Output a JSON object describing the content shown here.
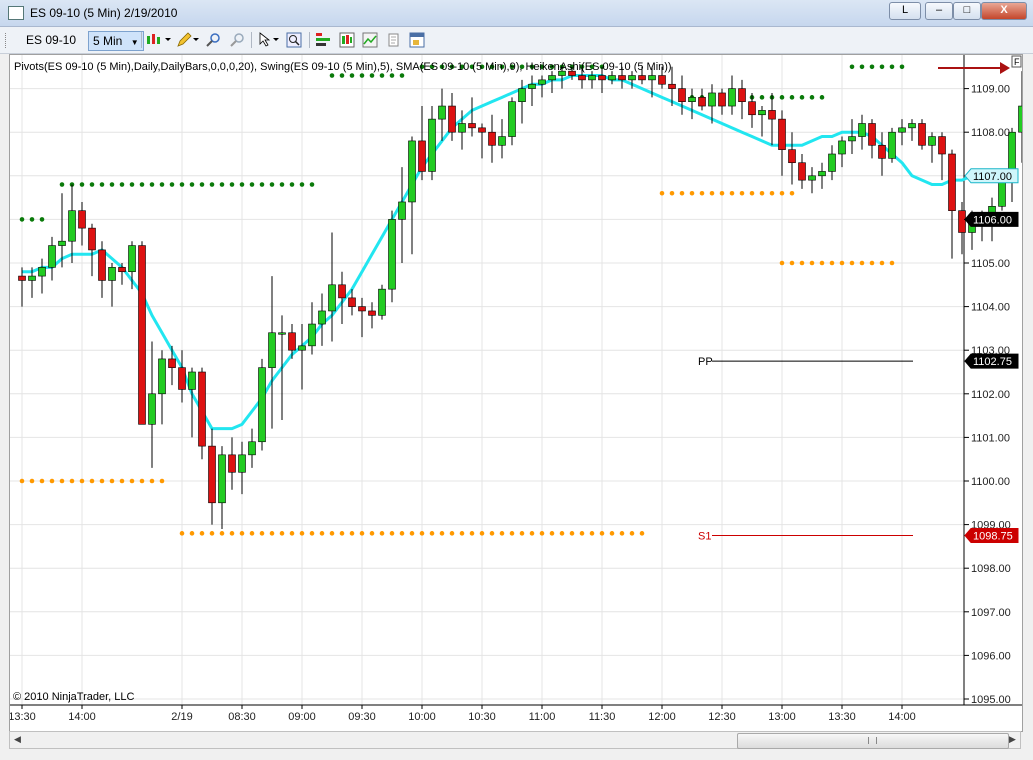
{
  "window": {
    "title": "ES 09-10 (5 Min)  2/19/2010",
    "btn_l": "L",
    "btn_min": "–",
    "btn_max": "□",
    "btn_close": "X"
  },
  "toolbar": {
    "instrument": "ES 09-10",
    "interval": "5 Min"
  },
  "chart": {
    "indicator_label": "Pivots(ES 09-10 (5 Min),Daily,DailyBars,0,0,0,20), Swing(ES 09-10 (5 Min),5), SMA(ES 09-10 (5 Min),9), HeikenAshi(ES 09-10 (5 Min))",
    "copyright": "© 2010 NinjaTrader, LLC",
    "corner_button": "F",
    "colors": {
      "up": "#22cc22",
      "down": "#dd1111",
      "sma": "#22e6f0",
      "swing_high": "#0a7a0a",
      "swing_low": "#ff9900"
    }
  },
  "chart_data": {
    "type": "candlestick",
    "ylim": [
      1094.8,
      1109.6
    ],
    "y_ticks": [
      "1095.00",
      "1096.00",
      "1097.00",
      "1098.00",
      "1099.00",
      "1100.00",
      "1101.00",
      "1102.00",
      "1103.00",
      "1104.00",
      "1105.00",
      "1106.00",
      "1107.00",
      "1108.00",
      "1109.00"
    ],
    "x_tick_labels": [
      "13:30",
      "14:00",
      "2/19",
      "08:30",
      "09:00",
      "09:30",
      "10:00",
      "10:30",
      "11:00",
      "11:30",
      "12:00",
      "12:30",
      "13:00",
      "13:30",
      "14:00"
    ],
    "x_tick_bars": [
      0,
      6,
      16,
      22,
      28,
      34,
      40,
      46,
      52,
      58,
      64,
      70,
      76,
      82,
      88
    ],
    "candles": [
      {
        "o": 1104.7,
        "h": 1104.9,
        "l": 1104.0,
        "c": 1104.6
      },
      {
        "o": 1104.6,
        "h": 1104.9,
        "l": 1104.2,
        "c": 1104.7
      },
      {
        "o": 1104.7,
        "h": 1105.1,
        "l": 1104.3,
        "c": 1104.9
      },
      {
        "o": 1104.9,
        "h": 1105.6,
        "l": 1104.6,
        "c": 1105.4
      },
      {
        "o": 1105.4,
        "h": 1106.6,
        "l": 1104.9,
        "c": 1105.5
      },
      {
        "o": 1105.5,
        "h": 1106.8,
        "l": 1105.0,
        "c": 1106.2
      },
      {
        "o": 1106.2,
        "h": 1106.4,
        "l": 1105.4,
        "c": 1105.8
      },
      {
        "o": 1105.8,
        "h": 1105.9,
        "l": 1104.7,
        "c": 1105.3
      },
      {
        "o": 1105.3,
        "h": 1105.5,
        "l": 1104.2,
        "c": 1104.6
      },
      {
        "o": 1104.6,
        "h": 1105.0,
        "l": 1104.0,
        "c": 1104.9
      },
      {
        "o": 1104.9,
        "h": 1105.0,
        "l": 1104.5,
        "c": 1104.8
      },
      {
        "o": 1104.8,
        "h": 1105.5,
        "l": 1104.4,
        "c": 1105.4
      },
      {
        "o": 1105.4,
        "h": 1105.5,
        "l": 1102.3,
        "c": 1101.3
      },
      {
        "o": 1101.3,
        "h": 1103.2,
        "l": 1100.3,
        "c": 1102.0
      },
      {
        "o": 1102.0,
        "h": 1103.0,
        "l": 1101.3,
        "c": 1102.8
      },
      {
        "o": 1102.8,
        "h": 1103.1,
        "l": 1102.2,
        "c": 1102.6
      },
      {
        "o": 1102.6,
        "h": 1103.0,
        "l": 1101.8,
        "c": 1102.1
      },
      {
        "o": 1102.1,
        "h": 1102.6,
        "l": 1101.0,
        "c": 1102.5
      },
      {
        "o": 1102.5,
        "h": 1102.6,
        "l": 1100.5,
        "c": 1100.8
      },
      {
        "o": 1100.8,
        "h": 1101.2,
        "l": 1099.0,
        "c": 1099.5
      },
      {
        "o": 1099.5,
        "h": 1100.8,
        "l": 1098.9,
        "c": 1100.6
      },
      {
        "o": 1100.6,
        "h": 1101.0,
        "l": 1099.8,
        "c": 1100.2
      },
      {
        "o": 1100.2,
        "h": 1100.9,
        "l": 1099.7,
        "c": 1100.6
      },
      {
        "o": 1100.6,
        "h": 1101.2,
        "l": 1100.3,
        "c": 1100.9
      },
      {
        "o": 1100.9,
        "h": 1102.8,
        "l": 1100.7,
        "c": 1102.6
      },
      {
        "o": 1102.6,
        "h": 1104.7,
        "l": 1101.2,
        "c": 1103.4
      },
      {
        "o": 1103.4,
        "h": 1103.8,
        "l": 1101.4,
        "c": 1103.4
      },
      {
        "o": 1103.4,
        "h": 1103.6,
        "l": 1102.8,
        "c": 1103.0
      },
      {
        "o": 1103.0,
        "h": 1103.6,
        "l": 1102.1,
        "c": 1103.1
      },
      {
        "o": 1103.1,
        "h": 1104.1,
        "l": 1102.9,
        "c": 1103.6
      },
      {
        "o": 1103.6,
        "h": 1104.3,
        "l": 1103.1,
        "c": 1103.9
      },
      {
        "o": 1103.9,
        "h": 1105.7,
        "l": 1103.2,
        "c": 1104.5
      },
      {
        "o": 1104.5,
        "h": 1104.8,
        "l": 1103.6,
        "c": 1104.2
      },
      {
        "o": 1104.2,
        "h": 1104.4,
        "l": 1103.8,
        "c": 1104.0
      },
      {
        "o": 1104.0,
        "h": 1104.2,
        "l": 1103.3,
        "c": 1103.9
      },
      {
        "o": 1103.9,
        "h": 1104.1,
        "l": 1103.5,
        "c": 1103.8
      },
      {
        "o": 1103.8,
        "h": 1104.5,
        "l": 1103.7,
        "c": 1104.4
      },
      {
        "o": 1104.4,
        "h": 1106.2,
        "l": 1104.1,
        "c": 1106.0
      },
      {
        "o": 1106.0,
        "h": 1107.2,
        "l": 1105.0,
        "c": 1106.4
      },
      {
        "o": 1106.4,
        "h": 1107.9,
        "l": 1105.2,
        "c": 1107.8
      },
      {
        "o": 1107.8,
        "h": 1108.6,
        "l": 1106.9,
        "c": 1107.1
      },
      {
        "o": 1107.1,
        "h": 1108.6,
        "l": 1106.9,
        "c": 1108.3
      },
      {
        "o": 1108.3,
        "h": 1109.0,
        "l": 1107.8,
        "c": 1108.6
      },
      {
        "o": 1108.6,
        "h": 1108.9,
        "l": 1107.8,
        "c": 1108.0
      },
      {
        "o": 1108.0,
        "h": 1108.5,
        "l": 1107.6,
        "c": 1108.2
      },
      {
        "o": 1108.2,
        "h": 1108.8,
        "l": 1107.9,
        "c": 1108.1
      },
      {
        "o": 1108.1,
        "h": 1108.2,
        "l": 1107.4,
        "c": 1108.0
      },
      {
        "o": 1108.0,
        "h": 1108.4,
        "l": 1107.3,
        "c": 1107.7
      },
      {
        "o": 1107.7,
        "h": 1108.3,
        "l": 1107.4,
        "c": 1107.9
      },
      {
        "o": 1107.9,
        "h": 1108.8,
        "l": 1107.7,
        "c": 1108.7
      },
      {
        "o": 1108.7,
        "h": 1109.2,
        "l": 1108.2,
        "c": 1109.0
      },
      {
        "o": 1109.0,
        "h": 1109.3,
        "l": 1108.6,
        "c": 1109.1
      },
      {
        "o": 1109.1,
        "h": 1109.3,
        "l": 1108.8,
        "c": 1109.2
      },
      {
        "o": 1109.2,
        "h": 1109.4,
        "l": 1108.9,
        "c": 1109.3
      },
      {
        "o": 1109.3,
        "h": 1109.5,
        "l": 1109.0,
        "c": 1109.4
      },
      {
        "o": 1109.4,
        "h": 1109.5,
        "l": 1109.2,
        "c": 1109.3
      },
      {
        "o": 1109.3,
        "h": 1109.5,
        "l": 1109.0,
        "c": 1109.2
      },
      {
        "o": 1109.2,
        "h": 1109.4,
        "l": 1109.0,
        "c": 1109.3
      },
      {
        "o": 1109.3,
        "h": 1109.5,
        "l": 1108.9,
        "c": 1109.2
      },
      {
        "o": 1109.2,
        "h": 1109.4,
        "l": 1109.1,
        "c": 1109.3
      },
      {
        "o": 1109.3,
        "h": 1109.5,
        "l": 1109.0,
        "c": 1109.2
      },
      {
        "o": 1109.2,
        "h": 1109.4,
        "l": 1109.0,
        "c": 1109.3
      },
      {
        "o": 1109.3,
        "h": 1109.5,
        "l": 1109.1,
        "c": 1109.2
      },
      {
        "o": 1109.2,
        "h": 1109.5,
        "l": 1108.8,
        "c": 1109.3
      },
      {
        "o": 1109.3,
        "h": 1109.5,
        "l": 1109.0,
        "c": 1109.1
      },
      {
        "o": 1109.1,
        "h": 1109.5,
        "l": 1108.6,
        "c": 1109.0
      },
      {
        "o": 1109.0,
        "h": 1109.3,
        "l": 1108.4,
        "c": 1108.7
      },
      {
        "o": 1108.7,
        "h": 1109.0,
        "l": 1108.3,
        "c": 1108.8
      },
      {
        "o": 1108.8,
        "h": 1109.0,
        "l": 1108.5,
        "c": 1108.6
      },
      {
        "o": 1108.6,
        "h": 1109.1,
        "l": 1108.2,
        "c": 1108.9
      },
      {
        "o": 1108.9,
        "h": 1109.0,
        "l": 1108.4,
        "c": 1108.6
      },
      {
        "o": 1108.6,
        "h": 1109.3,
        "l": 1108.4,
        "c": 1109.0
      },
      {
        "o": 1109.0,
        "h": 1109.2,
        "l": 1108.3,
        "c": 1108.7
      },
      {
        "o": 1108.7,
        "h": 1108.9,
        "l": 1108.1,
        "c": 1108.4
      },
      {
        "o": 1108.4,
        "h": 1108.6,
        "l": 1107.9,
        "c": 1108.5
      },
      {
        "o": 1108.5,
        "h": 1108.9,
        "l": 1107.7,
        "c": 1108.3
      },
      {
        "o": 1108.3,
        "h": 1108.5,
        "l": 1107.0,
        "c": 1107.6
      },
      {
        "o": 1107.6,
        "h": 1108.0,
        "l": 1106.8,
        "c": 1107.3
      },
      {
        "o": 1107.3,
        "h": 1107.5,
        "l": 1106.7,
        "c": 1106.9
      },
      {
        "o": 1106.9,
        "h": 1107.2,
        "l": 1106.6,
        "c": 1107.0
      },
      {
        "o": 1107.0,
        "h": 1107.3,
        "l": 1106.7,
        "c": 1107.1
      },
      {
        "o": 1107.1,
        "h": 1107.7,
        "l": 1106.9,
        "c": 1107.5
      },
      {
        "o": 1107.5,
        "h": 1107.9,
        "l": 1107.2,
        "c": 1107.8
      },
      {
        "o": 1107.8,
        "h": 1108.3,
        "l": 1107.5,
        "c": 1107.9
      },
      {
        "o": 1107.9,
        "h": 1108.4,
        "l": 1107.6,
        "c": 1108.2
      },
      {
        "o": 1108.2,
        "h": 1108.3,
        "l": 1107.4,
        "c": 1107.7
      },
      {
        "o": 1107.7,
        "h": 1108.0,
        "l": 1107.0,
        "c": 1107.4
      },
      {
        "o": 1107.4,
        "h": 1108.1,
        "l": 1107.3,
        "c": 1108.0
      },
      {
        "o": 1108.0,
        "h": 1108.3,
        "l": 1107.7,
        "c": 1108.1
      },
      {
        "o": 1108.1,
        "h": 1108.3,
        "l": 1107.8,
        "c": 1108.2
      },
      {
        "o": 1108.2,
        "h": 1108.3,
        "l": 1107.6,
        "c": 1107.7
      },
      {
        "o": 1107.7,
        "h": 1108.0,
        "l": 1107.3,
        "c": 1107.9
      },
      {
        "o": 1107.9,
        "h": 1108.0,
        "l": 1106.9,
        "c": 1107.5
      },
      {
        "o": 1107.5,
        "h": 1107.6,
        "l": 1105.1,
        "c": 1106.2
      },
      {
        "o": 1106.2,
        "h": 1106.4,
        "l": 1105.2,
        "c": 1105.7
      },
      {
        "o": 1105.7,
        "h": 1106.2,
        "l": 1105.3,
        "c": 1106.1
      },
      {
        "o": 1106.1,
        "h": 1106.2,
        "l": 1105.5,
        "c": 1106.0
      },
      {
        "o": 1106.0,
        "h": 1106.5,
        "l": 1105.5,
        "c": 1106.3
      },
      {
        "o": 1106.3,
        "h": 1107.1,
        "l": 1106.2,
        "c": 1107.1
      },
      {
        "o": 1107.1,
        "h": 1108.1,
        "l": 1106.4,
        "c": 1108.0
      },
      {
        "o": 1108.0,
        "h": 1109.4,
        "l": 1107.3,
        "c": 1108.6
      },
      {
        "o": 1108.6,
        "h": 1109.4,
        "l": 1107.1,
        "c": 1107.7
      },
      {
        "o": 1107.7,
        "h": 1107.9,
        "l": 1106.8,
        "c": 1107.0
      },
      {
        "o": 1107.0,
        "h": 1107.9,
        "l": 1106.2,
        "c": 1107.6
      },
      {
        "o": 1107.6,
        "h": 1107.7,
        "l": 1106.0,
        "c": 1106.5
      },
      {
        "o": 1106.5,
        "h": 1107.0,
        "l": 1105.3,
        "c": 1105.9
      },
      {
        "o": 1105.9,
        "h": 1106.5,
        "l": 1105.6,
        "c": 1106.3
      }
    ],
    "sma": [
      1104.8,
      1104.8,
      1104.9,
      1104.9,
      1105.1,
      1105.2,
      1105.2,
      1105.2,
      1105.3,
      1105.1,
      1104.9,
      1104.6,
      1104.3,
      1103.8,
      1103.4,
      1103.0,
      1102.6,
      1102.0,
      1101.6,
      1101.2,
      1101.2,
      1101.2,
      1101.3,
      1101.6,
      1101.9,
      1102.3,
      1102.6,
      1102.9,
      1103.1,
      1103.3,
      1103.6,
      1103.8,
      1104.1,
      1104.4,
      1104.8,
      1105.2,
      1105.6,
      1106.0,
      1106.4,
      1106.8,
      1107.2,
      1107.5,
      1107.8,
      1108.1,
      1108.3,
      1108.5,
      1108.6,
      1108.7,
      1108.8,
      1108.9,
      1109.0,
      1109.1,
      1109.1,
      1109.2,
      1109.2,
      1109.3,
      1109.3,
      1109.3,
      1109.3,
      1109.2,
      1109.2,
      1109.1,
      1109.0,
      1108.9,
      1108.8,
      1108.7,
      1108.6,
      1108.5,
      1108.4,
      1108.3,
      1108.2,
      1108.1,
      1108.0,
      1107.9,
      1107.8,
      1107.7,
      1107.7,
      1107.7,
      1107.7,
      1107.8,
      1107.9,
      1107.9,
      1108.0,
      1108.0,
      1108.0,
      1107.9,
      1107.7,
      1107.5,
      1107.3,
      1107.0,
      1106.9,
      1106.8,
      1106.8,
      1106.9,
      1106.9,
      1107.0,
      1107.0,
      1107.0,
      1107.1,
      1107.1
    ],
    "swing_highs": [
      {
        "y": 1106.0,
        "from": 0,
        "to": 2
      },
      {
        "y": 1106.8,
        "from": 4,
        "to": 29
      },
      {
        "y": 1109.3,
        "from": 31,
        "to": 38
      },
      {
        "y": 1109.5,
        "from": 40,
        "to": 58
      },
      {
        "y": 1108.8,
        "from": 67,
        "to": 80
      },
      {
        "y": 1109.5,
        "from": 83,
        "to": 88
      }
    ],
    "swing_lows": [
      {
        "y": 1100.0,
        "from": 0,
        "to": 14
      },
      {
        "y": 1098.8,
        "from": 16,
        "to": 62
      },
      {
        "y": 1106.6,
        "from": 64,
        "to": 77
      },
      {
        "y": 1105.0,
        "from": 76,
        "to": 87
      }
    ],
    "pivots": [
      {
        "name": "PP",
        "value": 1102.75,
        "label": "1102.75",
        "color": "#000000"
      },
      {
        "name": "S1",
        "value": 1098.75,
        "label": "1098.75",
        "color": "#cc0000"
      }
    ],
    "price_tags": [
      {
        "value": 1107.0,
        "label": "1107.00",
        "bg": "#cff6fb",
        "border": "#1ab6c9",
        "fg": "#000000"
      },
      {
        "value": 1106.0,
        "label": "1106.00",
        "bg": "#000000",
        "border": "#000000",
        "fg": "#ffffff"
      }
    ]
  }
}
